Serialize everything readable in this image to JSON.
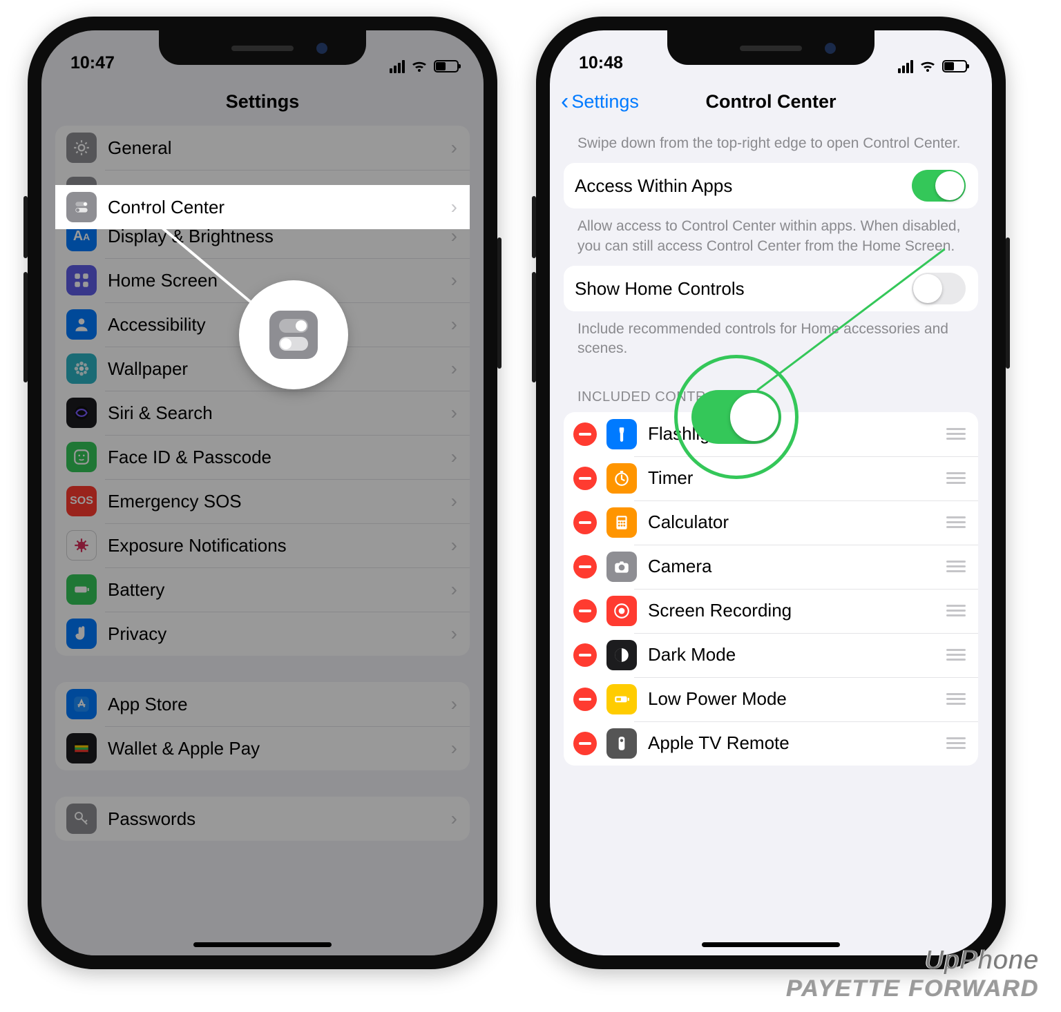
{
  "left": {
    "status_time": "10:47",
    "nav_title": "Settings",
    "menu": [
      {
        "label": "General",
        "icon": "gear-icon",
        "color": "gray"
      },
      {
        "label": "Control Center",
        "icon": "switches-icon",
        "color": "gray",
        "highlight": true
      },
      {
        "label": "Display & Brightness",
        "icon": "text-size-icon",
        "color": "blue"
      },
      {
        "label": "Home Screen",
        "icon": "grid-icon",
        "color": "purple"
      },
      {
        "label": "Accessibility",
        "icon": "person-icon",
        "color": "blue"
      },
      {
        "label": "Wallpaper",
        "icon": "flower-icon",
        "color": "teal"
      },
      {
        "label": "Siri & Search",
        "icon": "siri-icon",
        "color": "dark"
      },
      {
        "label": "Face ID & Passcode",
        "icon": "faceid-icon",
        "color": "green"
      },
      {
        "label": "Emergency SOS",
        "icon": "sos-icon",
        "color": "red"
      },
      {
        "label": "Exposure Notifications",
        "icon": "virus-icon",
        "color": "white"
      },
      {
        "label": "Battery",
        "icon": "battery-icon",
        "color": "green"
      },
      {
        "label": "Privacy",
        "icon": "hand-icon",
        "color": "blue"
      }
    ],
    "menu2": [
      {
        "label": "App Store",
        "icon": "appstore-icon",
        "color": "blue"
      },
      {
        "label": "Wallet & Apple Pay",
        "icon": "wallet-icon",
        "color": "dark"
      }
    ],
    "partial_row": "Passwords"
  },
  "right": {
    "status_time": "10:48",
    "back_label": "Settings",
    "nav_title": "Control Center",
    "hint_top": "Swipe down from the top-right edge to open Control Center.",
    "toggle1_label": "Access Within Apps",
    "toggle1_on": true,
    "hint_mid": "Allow access to Control Center within apps. When disabled, you can still access Control Center from the Home Screen.",
    "toggle2_label": "Show Home Controls",
    "toggle2_on": false,
    "hint_mid2": "Include recommended controls for Home accessories and scenes.",
    "section_header": "INCLUDED CONTROLS",
    "controls": [
      {
        "label": "Flashlight",
        "icon": "flashlight-icon",
        "color": "blue"
      },
      {
        "label": "Timer",
        "icon": "timer-icon",
        "color": "orange"
      },
      {
        "label": "Calculator",
        "icon": "calculator-icon",
        "color": "orange"
      },
      {
        "label": "Camera",
        "icon": "camera-icon",
        "color": "gray"
      },
      {
        "label": "Screen Recording",
        "icon": "record-icon",
        "color": "red"
      },
      {
        "label": "Dark Mode",
        "icon": "darkmode-icon",
        "color": "dark"
      },
      {
        "label": "Low Power Mode",
        "icon": "lowpower-icon",
        "color": "yellow"
      },
      {
        "label": "Apple TV Remote",
        "icon": "remote-icon",
        "color": "darkgrey"
      }
    ]
  },
  "watermark": {
    "line1": "UpPhone",
    "line2": "PAYETTE FORWARD"
  }
}
